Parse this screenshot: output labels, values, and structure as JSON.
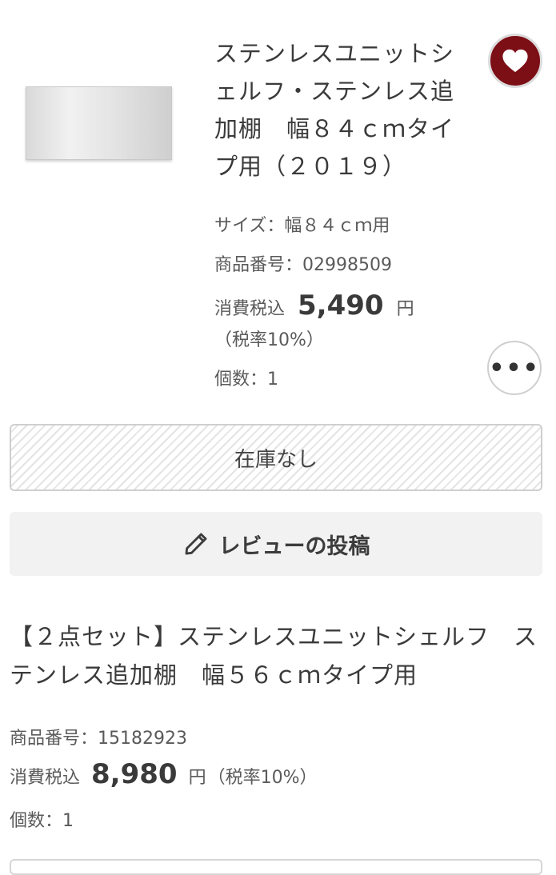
{
  "item1": {
    "title": "ステンレスユニットシェルフ・ステンレス追加棚　幅８４ｃｍタイプ用（２０１９）",
    "size": "サイズ：幅８４ｃｍ用",
    "product_number": "商品番号：02998509",
    "price_label": "消費税込",
    "price": "5,490",
    "price_unit": "円",
    "tax_rate": "（税率10%）",
    "quantity": "個数：1"
  },
  "favorite_icon": "heart-icon",
  "more_icon": "more-horizontal-icon",
  "stock_status": "在庫なし",
  "review_button": {
    "icon": "pencil-icon",
    "label": "レビューの投稿"
  },
  "item2": {
    "title": "【２点セット】ステンレスユニットシェルフ　ステンレス追加棚　幅５６ｃｍタイプ用",
    "product_number": "商品番号：15182923",
    "price_label": "消費税込",
    "price": "8,980",
    "price_unit": "円",
    "tax_rate": "（税率10%）",
    "quantity": "個数：1"
  },
  "colors": {
    "favorite_bg": "#7c0e16",
    "text": "#3a3a3a"
  }
}
